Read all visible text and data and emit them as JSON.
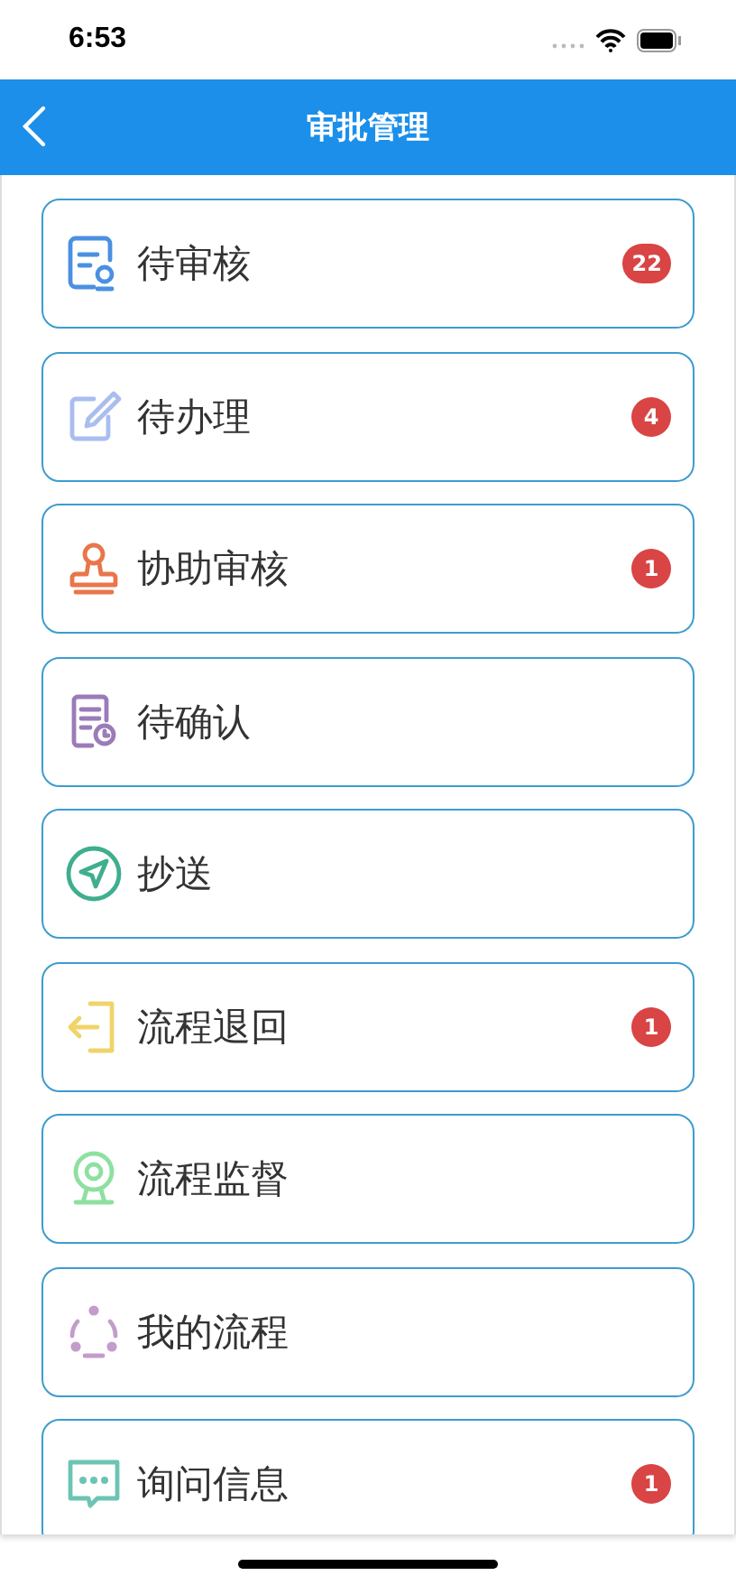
{
  "status_bar": {
    "time": "6:53"
  },
  "header": {
    "title": "审批管理"
  },
  "items": [
    {
      "label": "待审核",
      "kind": "review",
      "color": "#4a90e2",
      "badge": "22"
    },
    {
      "label": "待办理",
      "kind": "edit",
      "color": "#a9bdf0",
      "badge": "4"
    },
    {
      "label": "协助审核",
      "kind": "stamp",
      "color": "#e8764a",
      "badge": "1"
    },
    {
      "label": "待确认",
      "kind": "confirm",
      "color": "#9b7bb8"
    },
    {
      "label": "抄送",
      "kind": "send",
      "color": "#3fae8e"
    },
    {
      "label": "流程退回",
      "kind": "back",
      "color": "#f0d46a",
      "badge": "1"
    },
    {
      "label": "流程监督",
      "kind": "monitor",
      "color": "#8ee0a0"
    },
    {
      "label": "我的流程",
      "kind": "cycle",
      "color": "#c49ccc"
    },
    {
      "label": "询问信息",
      "kind": "chat",
      "color": "#6cc4b4",
      "badge": "1"
    }
  ]
}
